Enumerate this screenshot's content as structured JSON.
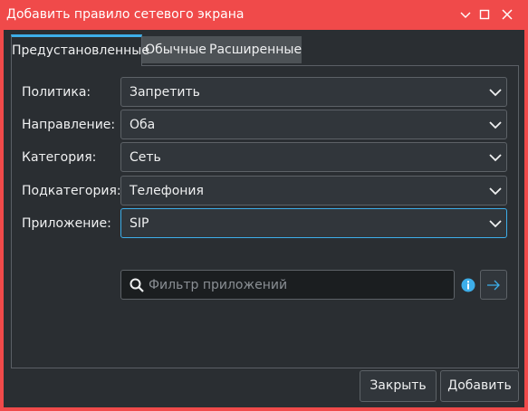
{
  "window": {
    "title": "Добавить правило сетевого экрана",
    "controls": [
      "minimize-icon",
      "maximize-icon",
      "close-icon"
    ],
    "accent_color": "#f04a4a"
  },
  "tabs": [
    {
      "label": "Предустановленные",
      "active": true
    },
    {
      "label": "Обычные",
      "active": false
    },
    {
      "label": "Расширенные",
      "active": false
    }
  ],
  "form": {
    "policy": {
      "label": "Политика:",
      "value": "Запретить"
    },
    "direction": {
      "label": "Направление:",
      "value": "Оба"
    },
    "category": {
      "label": "Категория:",
      "value": "Сеть"
    },
    "subcategory": {
      "label": "Подкатегория:",
      "value": "Телефония"
    },
    "application": {
      "label": "Приложение:",
      "value": "SIP"
    },
    "filter": {
      "placeholder": "Фильтр приложений",
      "value": ""
    }
  },
  "footer": {
    "close_label": "Закрыть",
    "add_label": "Добавить"
  },
  "colors": {
    "focus": "#3daee9",
    "background": "#2a2e32"
  }
}
